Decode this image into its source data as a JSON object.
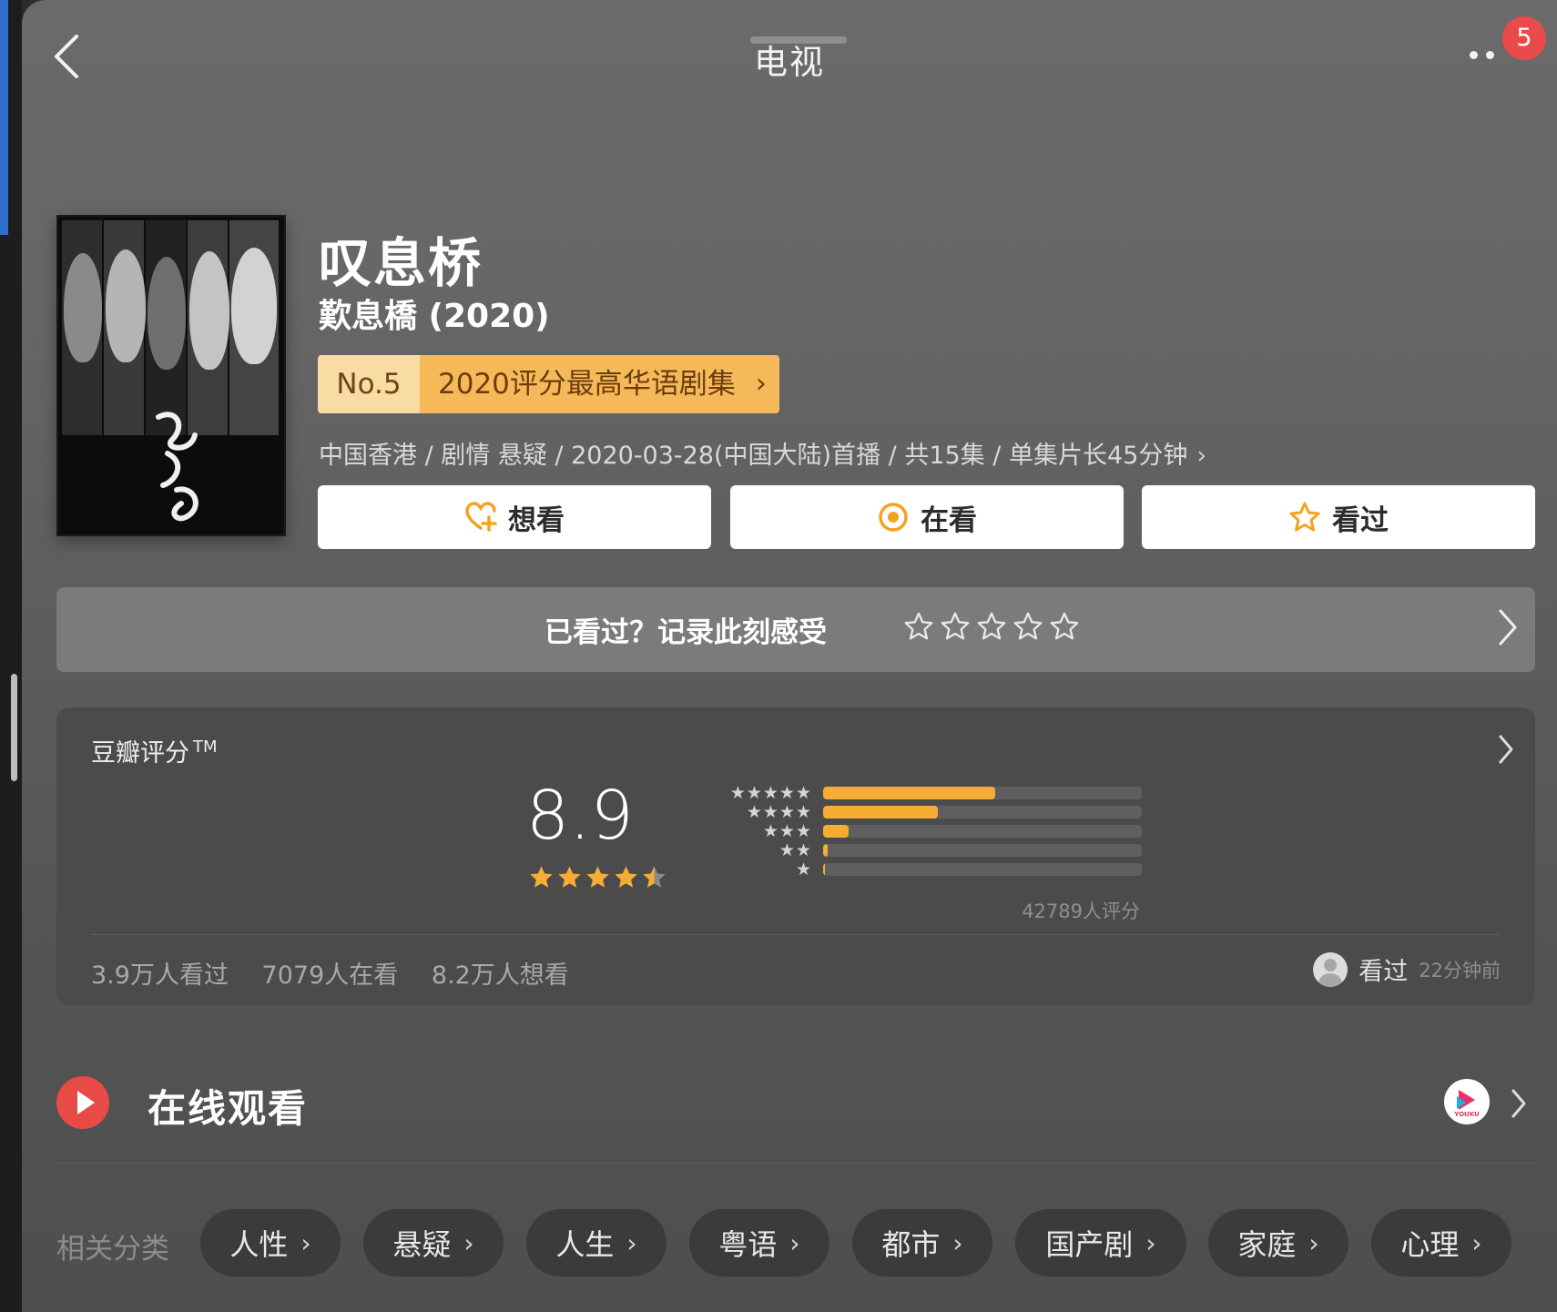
{
  "header": {
    "title": "电视",
    "notification_count": "5"
  },
  "subject": {
    "title": "叹息桥",
    "original_title": "歎息橋 (2020)",
    "rank": {
      "no": "No.5",
      "list": "2020评分最高华语剧集"
    },
    "meta": "中国香港 / 剧情 悬疑 / 2020-03-28(中国大陆)首播 / 共15集 / 单集片长45分钟"
  },
  "actions": {
    "want": "想看",
    "watching": "在看",
    "watched": "看过"
  },
  "rate_prompt": "已看过？记录此刻感受",
  "rating": {
    "label": "豆瓣评分",
    "tm": "TM",
    "score": "8.9",
    "stars_value": 4.5,
    "distribution": [
      {
        "stars": "★★★★★",
        "fraction": 0.54
      },
      {
        "stars": "★★★★",
        "fraction": 0.36
      },
      {
        "stars": "★★★",
        "fraction": 0.08
      },
      {
        "stars": "★★",
        "fraction": 0.015
      },
      {
        "stars": "★",
        "fraction": 0.007
      }
    ],
    "count": "42789人评分",
    "stats": {
      "watched": "3.9万人看过",
      "watching": "7079人在看",
      "want": "8.2万人想看"
    },
    "friend": {
      "action": "看过",
      "time": "22分钟前"
    }
  },
  "online": {
    "title": "在线观看",
    "provider_icon": "youku-icon"
  },
  "tags": {
    "label": "相关分类",
    "items": [
      "人性",
      "悬疑",
      "人生",
      "粤语",
      "都市",
      "国产剧",
      "家庭",
      "心理"
    ]
  },
  "colors": {
    "accent": "#f7ac34",
    "rank_bg": "#f6b95a",
    "badge": "#e94b4b"
  }
}
